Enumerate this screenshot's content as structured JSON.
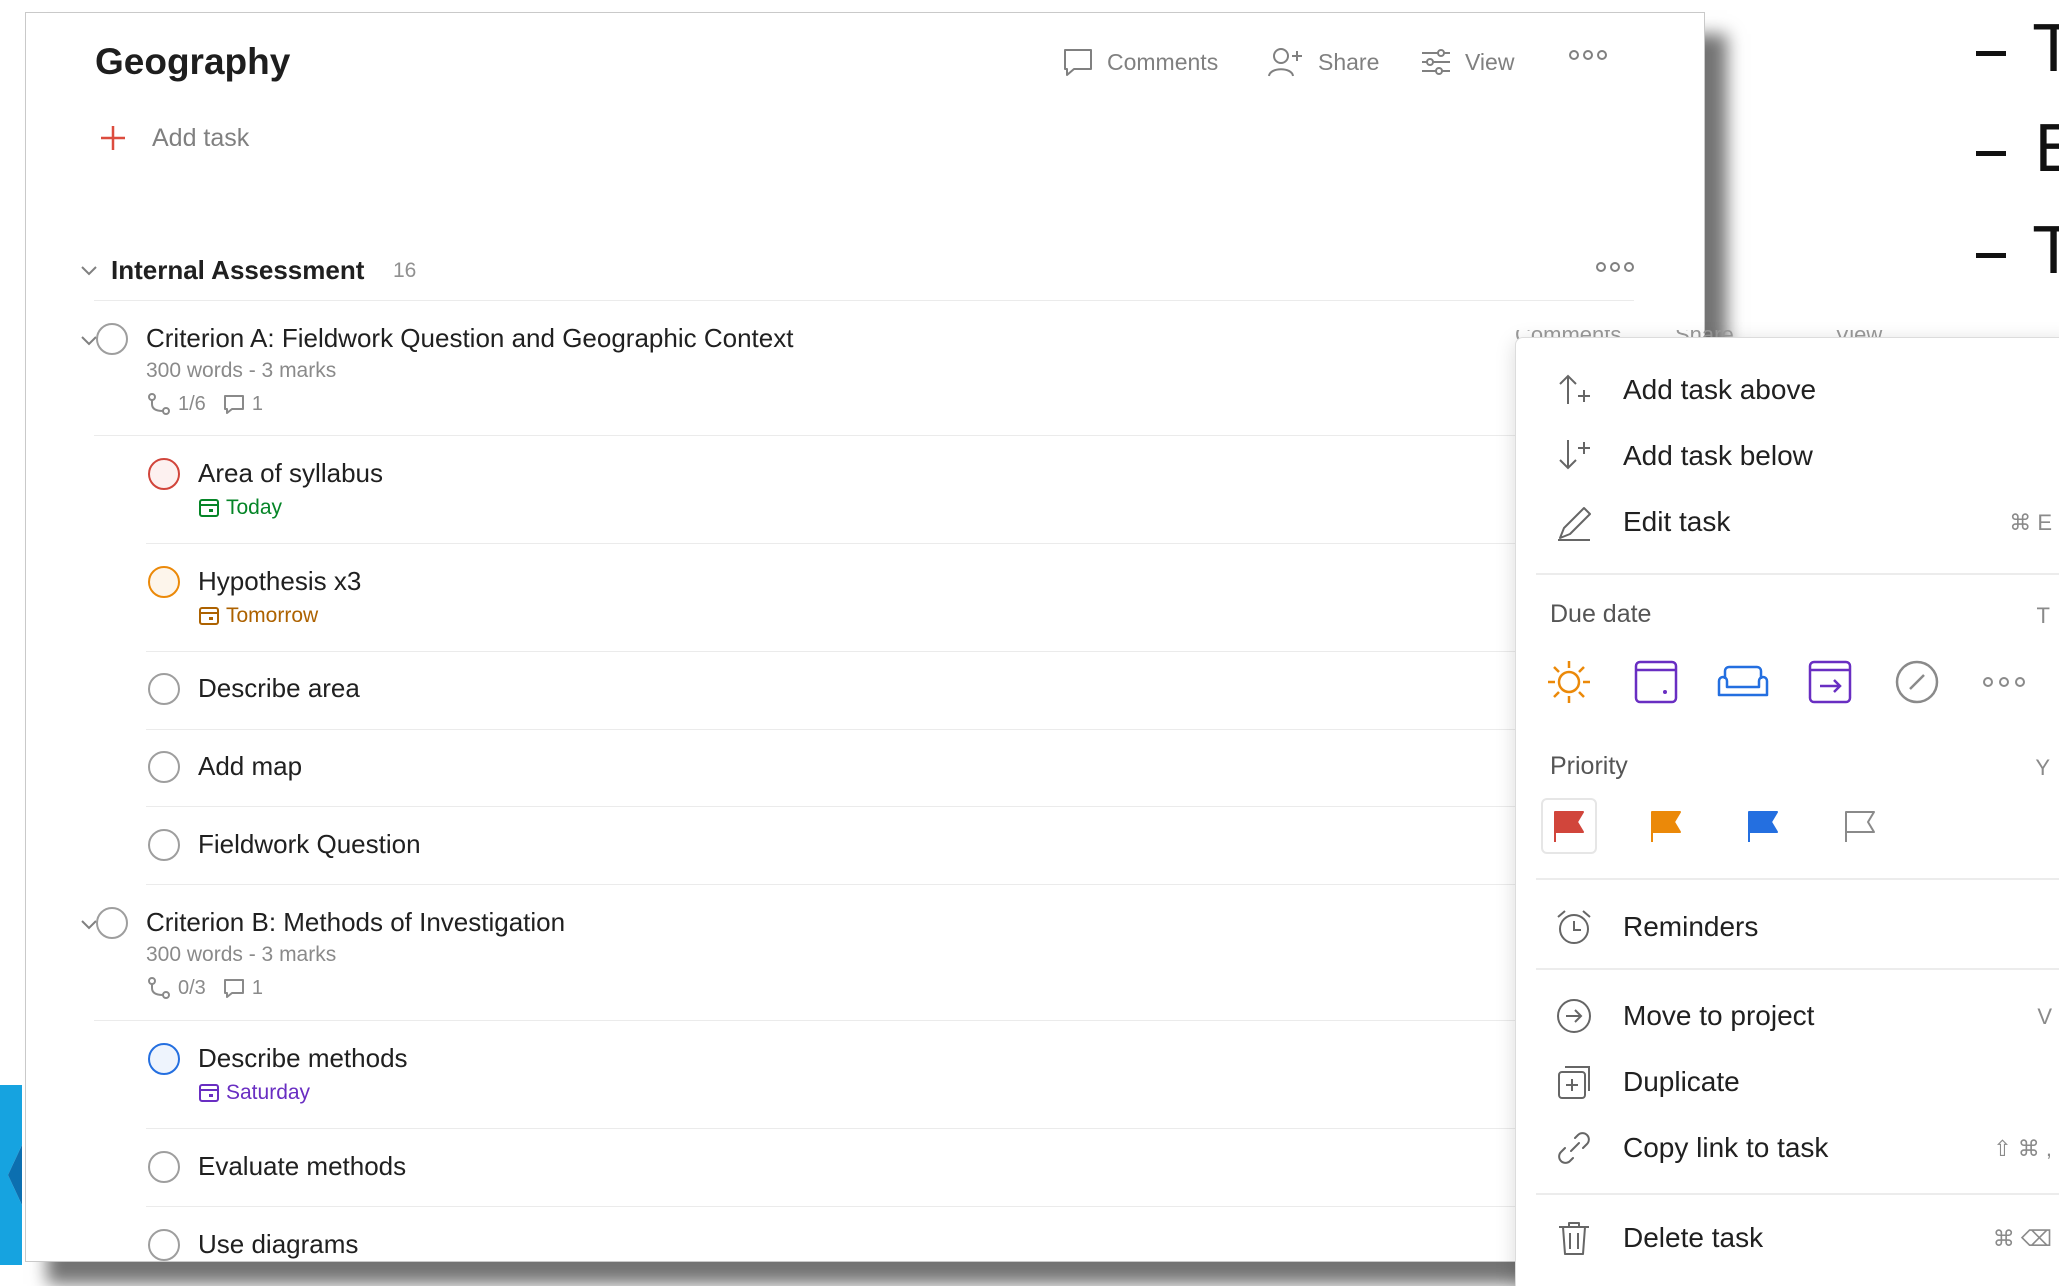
{
  "colors": {
    "accent": "#dc4c3e",
    "priority1": "#d1453b",
    "priority2": "#eb8909",
    "priority3": "#246fe0",
    "today": "#058527",
    "tomorrow": "#ad6200",
    "saturday": "#692ec2"
  },
  "header": {
    "title": "Geography",
    "comments_label": "Comments",
    "share_label": "Share",
    "view_label": "View"
  },
  "add_task_label": "Add task",
  "section": {
    "title": "Internal Assessment",
    "count": "16"
  },
  "tasks": [
    {
      "name": "Criterion A: Fieldwork Question and Geographic Context",
      "description": "300 words - 3 marks",
      "subtasks": "1/6",
      "comments": "1"
    },
    {
      "name": "Area of syllabus",
      "priority": "p1",
      "date": "Today"
    },
    {
      "name": "Hypothesis x3",
      "priority": "p2",
      "date": "Tomorrow"
    },
    {
      "name": "Describe area"
    },
    {
      "name": "Add map"
    },
    {
      "name": "Fieldwork Question"
    },
    {
      "name": "Criterion B: Methods of Investigation",
      "description": "300 words - 3 marks",
      "subtasks": "0/3",
      "comments": "1"
    },
    {
      "name": "Describe methods",
      "priority": "p3",
      "date": "Saturday"
    },
    {
      "name": "Evaluate methods"
    },
    {
      "name": "Use diagrams"
    }
  ],
  "menu": {
    "add_above": "Add task above",
    "add_below": "Add task below",
    "edit": "Edit task",
    "edit_shortcut": "⌘ E",
    "due_date_heading": "Due date",
    "due_date_shortcut": "T",
    "due_options": [
      "sun-icon",
      "calendar-icon",
      "sofa-icon",
      "calendar-arrow-icon",
      "no-date-icon",
      "more-icon"
    ],
    "priority_heading": "Priority",
    "priority_shortcut": "Y",
    "priority_options": [
      "priority-1",
      "priority-2",
      "priority-3",
      "priority-4"
    ],
    "reminders": "Reminders",
    "move": "Move to project",
    "move_shortcut": "V",
    "duplicate": "Duplicate",
    "copy_link": "Copy link to task",
    "copy_link_shortcut": "⇧ ⌘ ,",
    "delete": "Delete task",
    "delete_shortcut": "⌘ ⌫"
  },
  "background_bullets": [
    "T",
    "E",
    "T"
  ]
}
